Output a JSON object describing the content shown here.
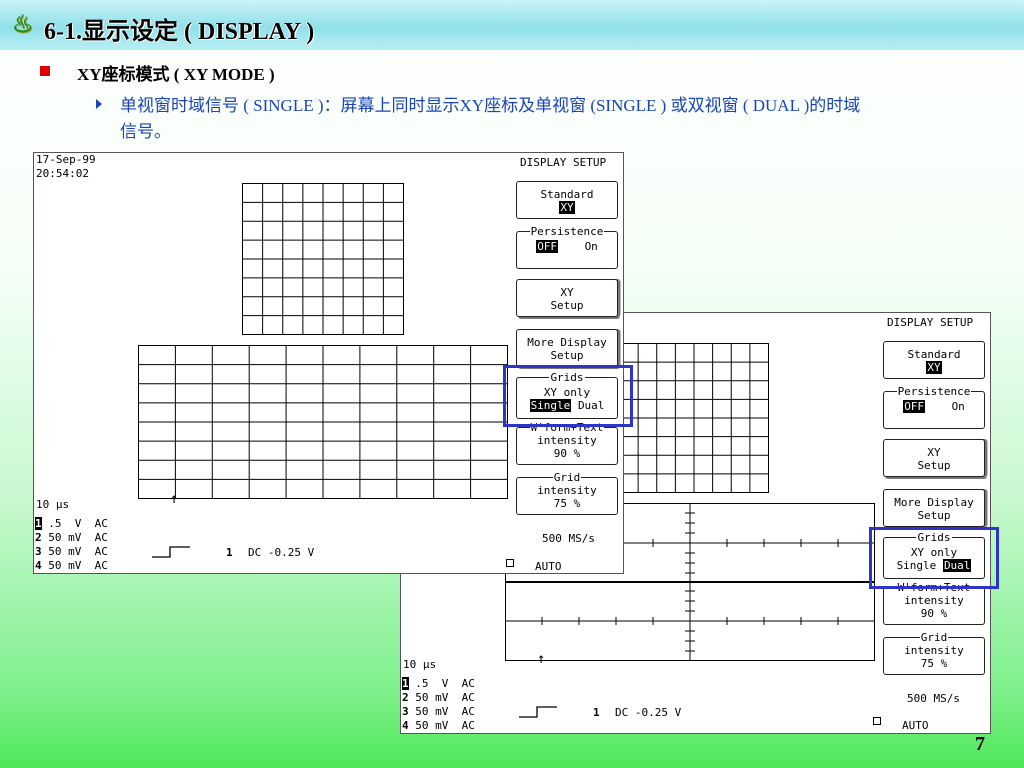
{
  "slide": {
    "title": "6-1.显示设定 ( DISPLAY )",
    "subtitle": "XY座标模式 ( XY MODE )",
    "desc_line1": "单视窗时域信号 ( SINGLE )：屏幕上同时显示XY座标及单视窗 (SINGLE ) 或双视窗 ( DUAL )的时域",
    "desc_line2": "信号。",
    "page_number": "7",
    "accent": "#1b44b8",
    "bullet_color": "#e00000"
  },
  "scope_front": {
    "date": "17-Sep-99",
    "time": "20:54:02",
    "menu_title": "DISPLAY SETUP",
    "standard_label": "Standard",
    "standard_value": "XY",
    "persistence_label": "Persistence",
    "persistence_off": "OFF",
    "persistence_on": "On",
    "xy_setup_l1": "XY",
    "xy_setup_l2": "Setup",
    "more_l1": "More Display",
    "more_l2": "Setup",
    "grids_label": "Grids",
    "grids_l1": "XY only",
    "grids_single": "Single",
    "grids_dual": "Dual",
    "wform_label": "W'form+Text",
    "wform_l1": "intensity",
    "wform_l2": "90 %",
    "grid_label": "Grid",
    "grid_l1": "intensity",
    "grid_l2": "75 %",
    "timebase": "10 µs",
    "samplerate": "500 MS/s",
    "trig_ch": "1",
    "trig_info": "DC -0.25 V",
    "mode": "AUTO",
    "channels": [
      {
        "n": "1",
        "v": " .5  V  AC"
      },
      {
        "n": "2",
        "v": " 50 mV  AC"
      },
      {
        "n": "3",
        "v": " 50 mV  AC"
      },
      {
        "n": "4",
        "v": " 50 mV  AC"
      }
    ]
  },
  "scope_back": {
    "menu_title": "DISPLAY SETUP",
    "standard_label": "Standard",
    "standard_value": "XY",
    "persistence_label": "Persistence",
    "persistence_off": "OFF",
    "persistence_on": "On",
    "xy_setup_l1": "XY",
    "xy_setup_l2": "Setup",
    "more_l1": "More Display",
    "more_l2": "Setup",
    "grids_label": "Grids",
    "grids_l1": "XY only",
    "grids_single": "Single",
    "grids_dual": "Dual",
    "wform_label": "W'form+Text",
    "wform_l1": "intensity",
    "wform_l2": "90 %",
    "grid_label": "Grid",
    "grid_l1": "intensity",
    "grid_l2": "75 %",
    "timebase": "10 µs",
    "samplerate": "500 MS/s",
    "trig_ch": "1",
    "trig_info": "DC -0.25 V",
    "mode": "AUTO",
    "channels": [
      {
        "n": "1",
        "v": " .5  V  AC"
      },
      {
        "n": "2",
        "v": " 50 mV  AC"
      },
      {
        "n": "3",
        "v": " 50 mV  AC"
      },
      {
        "n": "4",
        "v": " 50 mV  AC"
      }
    ]
  },
  "colors": {
    "highlight": "#2f33c8",
    "title_icon": "#2a8a1c"
  },
  "icons": {
    "title_icon": "running-figure-icon"
  }
}
